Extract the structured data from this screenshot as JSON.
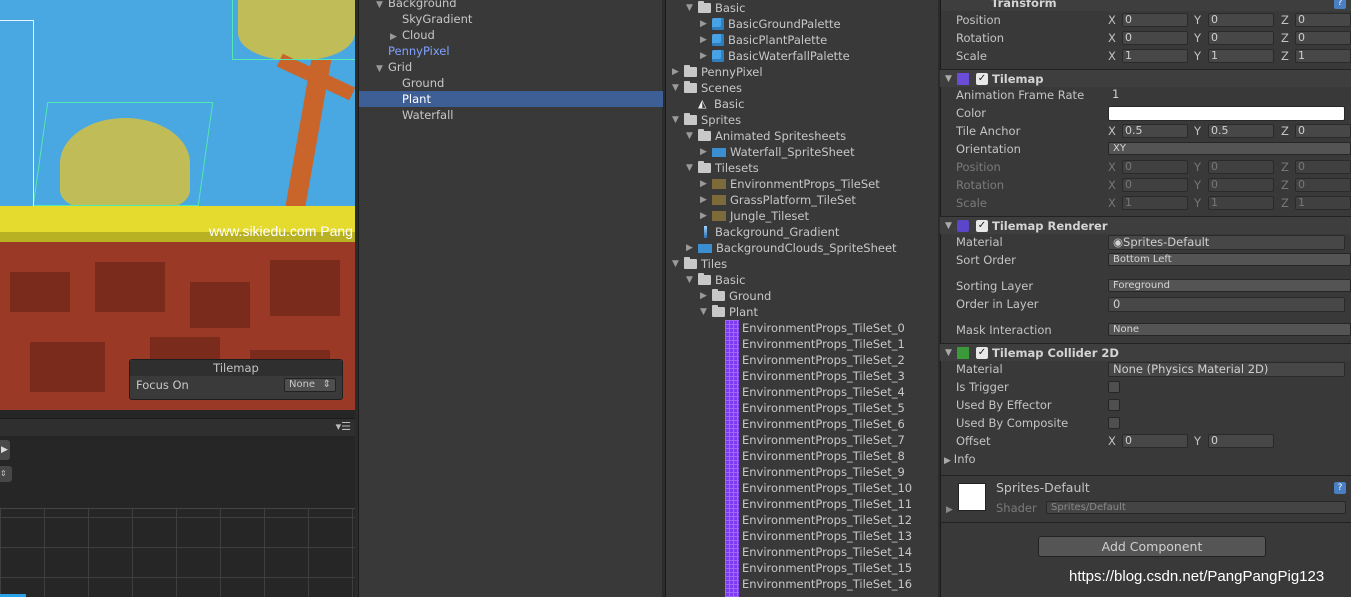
{
  "scene": {
    "watermark_text": "www.sikiedu.com Pang",
    "overlay": {
      "title": "Tilemap",
      "focus_label": "Focus On",
      "focus_value": "None"
    }
  },
  "hierarchy": {
    "items": [
      {
        "label": "Background",
        "indent": 0,
        "arrow": "▼",
        "color": "#c7c7c7"
      },
      {
        "label": "SkyGradient",
        "indent": 1,
        "arrow": "",
        "color": "#c7c7c7"
      },
      {
        "label": "Cloud",
        "indent": 1,
        "arrow": "▶",
        "color": "#c7c7c7"
      },
      {
        "label": "PennyPixel",
        "indent": 0,
        "arrow": "",
        "color": "#7fa2ff"
      },
      {
        "label": "Grid",
        "indent": 0,
        "arrow": "▼",
        "color": "#c7c7c7"
      },
      {
        "label": "Ground",
        "indent": 1,
        "arrow": "",
        "color": "#c7c7c7"
      },
      {
        "label": "Plant",
        "indent": 1,
        "arrow": "",
        "color": "#ffffff"
      },
      {
        "label": "Waterfall",
        "indent": 1,
        "arrow": "",
        "color": "#c7c7c7"
      }
    ]
  },
  "project": {
    "items": [
      {
        "label": "Basic",
        "icon": "folder",
        "arrow": "▼",
        "level": 1
      },
      {
        "label": "BasicGroundPalette",
        "icon": "prefab",
        "arrow": "▶",
        "level": 2
      },
      {
        "label": "BasicPlantPalette",
        "icon": "prefab",
        "arrow": "▶",
        "level": 2
      },
      {
        "label": "BasicWaterfallPalette",
        "icon": "prefab",
        "arrow": "▶",
        "level": 2
      },
      {
        "label": "PennyPixel",
        "icon": "folder",
        "arrow": "▶",
        "level": 0
      },
      {
        "label": "Scenes",
        "icon": "folder",
        "arrow": "▼",
        "level": 0
      },
      {
        "label": "Basic",
        "icon": "unity",
        "arrow": "",
        "level": 1
      },
      {
        "label": "Sprites",
        "icon": "folder",
        "arrow": "▼",
        "level": 0
      },
      {
        "label": "Animated Spritesheets",
        "icon": "folder",
        "arrow": "▼",
        "level": 1
      },
      {
        "label": "Waterfall_SpriteSheet",
        "icon": "sheet",
        "arrow": "▶",
        "level": 2
      },
      {
        "label": "Tilesets",
        "icon": "folder",
        "arrow": "▼",
        "level": 1
      },
      {
        "label": "EnvironmentProps_TileSet",
        "icon": "tileset",
        "arrow": "▶",
        "level": 2
      },
      {
        "label": "GrassPlatform_TileSet",
        "icon": "tileset",
        "arrow": "▶",
        "level": 2
      },
      {
        "label": "Jungle_Tileset",
        "icon": "tileset",
        "arrow": "▶",
        "level": 2
      },
      {
        "label": "Background_Gradient",
        "icon": "gradient",
        "arrow": "",
        "level": 1
      },
      {
        "label": "BackgroundClouds_SpriteSheet",
        "icon": "sheet",
        "arrow": "▶",
        "level": 1
      },
      {
        "label": "Tiles",
        "icon": "folder",
        "arrow": "▼",
        "level": 0
      },
      {
        "label": "Basic",
        "icon": "folder",
        "arrow": "▼",
        "level": 1
      },
      {
        "label": "Ground",
        "icon": "folder",
        "arrow": "▶",
        "level": 2
      },
      {
        "label": "Plant",
        "icon": "folder",
        "arrow": "▼",
        "level": 2
      }
    ],
    "tiles": [
      "EnvironmentProps_TileSet_0",
      "EnvironmentProps_TileSet_1",
      "EnvironmentProps_TileSet_2",
      "EnvironmentProps_TileSet_3",
      "EnvironmentProps_TileSet_4",
      "EnvironmentProps_TileSet_5",
      "EnvironmentProps_TileSet_6",
      "EnvironmentProps_TileSet_7",
      "EnvironmentProps_TileSet_8",
      "EnvironmentProps_TileSet_9",
      "EnvironmentProps_TileSet_10",
      "EnvironmentProps_TileSet_11",
      "EnvironmentProps_TileSet_12",
      "EnvironmentProps_TileSet_13",
      "EnvironmentProps_TileSet_14",
      "EnvironmentProps_TileSet_15",
      "EnvironmentProps_TileSet_16"
    ]
  },
  "inspector": {
    "transform": {
      "title": "Transform",
      "position_label": "Position",
      "position": [
        "0",
        "0",
        "0"
      ],
      "rotation_label": "Rotation",
      "rotation": [
        "0",
        "0",
        "0"
      ],
      "scale_label": "Scale",
      "scale": [
        "1",
        "1",
        "1"
      ]
    },
    "tilemap": {
      "title": "Tilemap",
      "frame_rate_label": "Animation Frame Rate",
      "frame_rate": "1",
      "color_label": "Color",
      "anchor_label": "Tile Anchor",
      "anchor": [
        "0.5",
        "0.5",
        "0"
      ],
      "orientation_label": "Orientation",
      "orientation": "XY",
      "position_label": "Position",
      "position": [
        "0",
        "0",
        "0"
      ],
      "rotation_label": "Rotation",
      "rotation": [
        "0",
        "0",
        "0"
      ],
      "scale_label": "Scale",
      "scale": [
        "1",
        "1",
        "1"
      ]
    },
    "renderer": {
      "title": "Tilemap Renderer",
      "material_label": "Material",
      "material": "Sprites-Default",
      "sort_order_label": "Sort Order",
      "sort_order": "Bottom Left",
      "sorting_layer_label": "Sorting Layer",
      "sorting_layer": "Foreground",
      "order_label": "Order in Layer",
      "order": "0",
      "mask_label": "Mask Interaction",
      "mask": "None"
    },
    "collider": {
      "title": "Tilemap Collider 2D",
      "material_label": "Material",
      "material": "None (Physics Material 2D)",
      "trigger_label": "Is Trigger",
      "effector_label": "Used By Effector",
      "composite_label": "Used By Composite",
      "offset_label": "Offset",
      "offset": [
        "0",
        "0"
      ],
      "info_label": "Info"
    },
    "material_preview": {
      "name": "Sprites-Default",
      "shader_label": "Shader",
      "shader": "Sprites/Default"
    },
    "add_component": "Add Component"
  },
  "watermark_url": "https://blog.csdn.net/PangPangPig123"
}
